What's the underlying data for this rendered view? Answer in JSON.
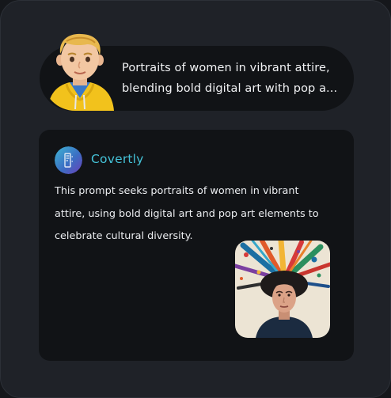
{
  "user_message": {
    "avatar": "cartoon-man-avatar",
    "text": "Portraits of women in vibrant attire, blending bold digital art with pop a..."
  },
  "response": {
    "logo": "covertly-logo-icon",
    "brand_name": "Covertly",
    "brand_color": "#45c3d9",
    "text": "This prompt seeks portraits of women in vibrant attire, using bold digital art and pop art elements to celebrate cultural diversity.",
    "image": "generated-portrait-thumbnail"
  },
  "colors": {
    "background": "#1f2228",
    "panel": "#111316",
    "text": "#f1f2f4"
  }
}
